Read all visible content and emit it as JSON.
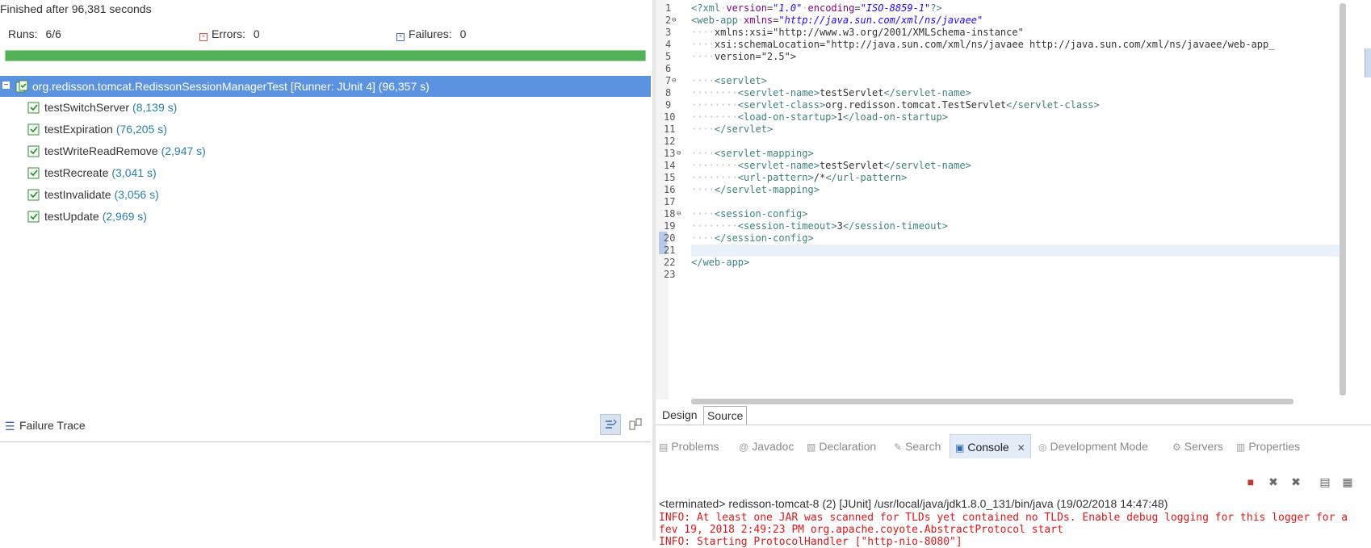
{
  "junit": {
    "finished": "Finished after 96,381 seconds",
    "runs_label": "Runs:",
    "runs_value": "6/6",
    "errors_label": "Errors:",
    "errors_value": "0",
    "failures_label": "Failures:",
    "failures_value": "0",
    "progress_fraction": 1.0,
    "progress_color": "#53b257",
    "suite": "org.redisson.tomcat.RedissonSessionManagerTest [Runner: JUnit 4] (96,357 s)",
    "tests": [
      {
        "name": "testSwitchServer",
        "time": "(8,139 s)"
      },
      {
        "name": "testExpiration",
        "time": "(76,205 s)"
      },
      {
        "name": "testWriteReadRemove",
        "time": "(2,947 s)"
      },
      {
        "name": "testRecreate",
        "time": "(3,041 s)"
      },
      {
        "name": "testInvalidate",
        "time": "(3,056 s)"
      },
      {
        "name": "testUpdate",
        "time": "(2,969 s)"
      }
    ],
    "failure_trace": "Failure Trace"
  },
  "editor": {
    "line_numbers": [
      "1",
      "2",
      "3",
      "4",
      "5",
      "6",
      "7",
      "8",
      "9",
      "10",
      "11",
      "12",
      "13",
      "14",
      "15",
      "16",
      "17",
      "18",
      "19",
      "20",
      "21",
      "22",
      "23"
    ],
    "lines": [
      "<?xml version=\"1.0\" encoding=\"ISO-8859-1\"?>",
      "<web-app xmlns=\"http://java.sun.com/xml/ns/javaee\"",
      "    xmlns:xsi=\"http://www.w3.org/2001/XMLSchema-instance\"",
      "    xsi:schemaLocation=\"http://java.sun.com/xml/ns/javaee http://java.sun.com/xml/ns/javaee/web-app_",
      "    version=\"2.5\">",
      "",
      "    <servlet>",
      "        <servlet-name>testServlet</servlet-name>",
      "        <servlet-class>org.redisson.tomcat.TestServlet</servlet-class>",
      "        <load-on-startup>1</load-on-startup>",
      "    </servlet>",
      "",
      "    <servlet-mapping>",
      "        <servlet-name>testServlet</servlet-name>",
      "        <url-pattern>/*</url-pattern>",
      "    </servlet-mapping>",
      "",
      "    <session-config>",
      "        <session-timeout>3</session-timeout>",
      "    </session-config>",
      "",
      "</web-app>",
      ""
    ],
    "tabs": [
      "Design",
      "Source"
    ],
    "active_tab": "Source"
  },
  "views": {
    "tabs": [
      {
        "label": "Problems",
        "icon": "problems-icon"
      },
      {
        "label": "Javadoc",
        "icon": "javadoc-icon"
      },
      {
        "label": "Declaration",
        "icon": "declaration-icon"
      },
      {
        "label": "Search",
        "icon": "search-icon"
      },
      {
        "label": "Console",
        "icon": "console-icon"
      },
      {
        "label": "Development Mode",
        "icon": "devmode-icon"
      },
      {
        "label": "Servers",
        "icon": "servers-icon"
      },
      {
        "label": "Properties",
        "icon": "properties-icon"
      }
    ],
    "active_tab": "Console",
    "terminated": "<terminated> redisson-tomcat-8 (2) [JUnit] /usr/local/java/jdk1.8.0_131/bin/java (19/02/2018 14:47:48)",
    "console_lines": [
      "INFO: At least one JAR was scanned for TLDs yet contained no TLDs. Enable debug logging for this logger for a",
      "fev 19, 2018 2:49:23 PM org.apache.coyote.AbstractProtocol start",
      "INFO: Starting ProtocolHandler [\"http-nio-8080\"]"
    ],
    "error_color": "#e0171a"
  }
}
